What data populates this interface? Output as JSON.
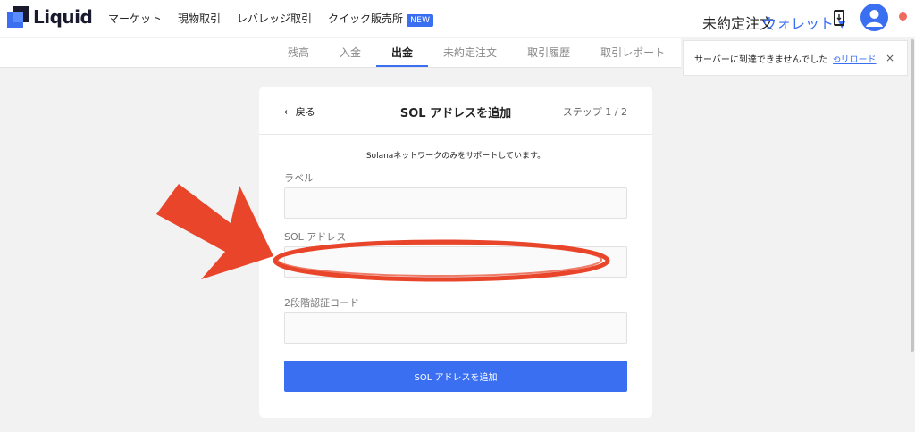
{
  "header": {
    "logo_text": "Liquid",
    "nav": [
      {
        "label": "マーケット"
      },
      {
        "label": "現物取引"
      },
      {
        "label": "レバレッジ取引"
      },
      {
        "label": "クイック販売所",
        "badge": "NEW"
      }
    ],
    "open_orders": "未約定注文",
    "wallet": "ウォレット ▾"
  },
  "tabs": [
    {
      "label": "残高"
    },
    {
      "label": "入金"
    },
    {
      "label": "出金",
      "active": true
    },
    {
      "label": "未約定注文"
    },
    {
      "label": "取引履歴"
    },
    {
      "label": "取引レポート"
    }
  ],
  "toast": {
    "message": "サーバーに到達できませんでした",
    "reload": "⟲リロード",
    "close": "×"
  },
  "card": {
    "back": "← 戻る",
    "title": "SOL アドレスを追加",
    "step": "ステップ 1 / 2",
    "notice": "Solanaネットワークのみをサポートしています。",
    "fields": {
      "label": {
        "label": "ラベル",
        "value": ""
      },
      "address": {
        "label": "SOL アドレス",
        "value": ""
      },
      "twofa": {
        "label": "2段階認証コード",
        "value": ""
      }
    },
    "submit": "SOL アドレスを追加"
  },
  "colors": {
    "accent": "#3b6ff2",
    "annotation": "#e8452a",
    "status_dot": "#ef6b5e"
  }
}
